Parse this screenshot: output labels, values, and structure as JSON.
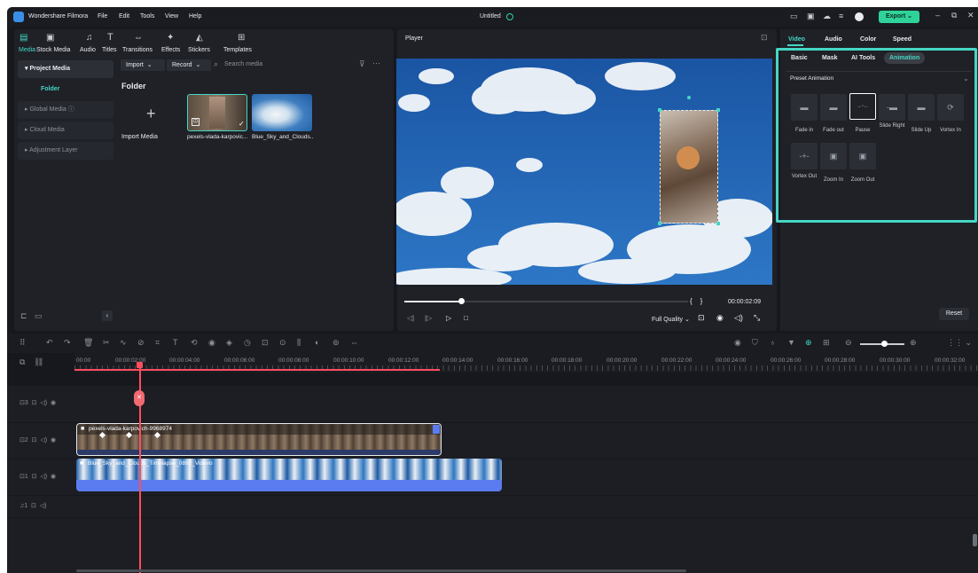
{
  "app": {
    "name": "Wondershare Filmora",
    "project_title": "Untitled",
    "menu": [
      "File",
      "Edit",
      "Tools",
      "View",
      "Help"
    ],
    "export_label": "Export"
  },
  "toolbar": {
    "tabs": [
      "Media",
      "Stock Media",
      "Audio",
      "Titles",
      "Transitions",
      "Effects",
      "Stickers",
      "Templates"
    ],
    "active_tab": "Media"
  },
  "sidebar": {
    "items": [
      "Project Media",
      "Folder",
      "Global Media",
      "Cloud Media",
      "Adjustment Layer"
    ]
  },
  "media": {
    "import_label": "Import",
    "record_label": "Record",
    "search_placeholder": "Search media",
    "folder_title": "Folder",
    "import_media_label": "Import Media",
    "clips": [
      "pexels-vlada-karpovic...",
      "Blue_Sky_and_Clouds..."
    ]
  },
  "player": {
    "title": "Player",
    "timecode": "00:00:02:09",
    "quality": "Full Quality",
    "progress": 0.2
  },
  "properties": {
    "tabs": [
      "Video",
      "Audio",
      "Color",
      "Speed"
    ],
    "active_tab": "Video",
    "subtabs": [
      "Basic",
      "Mask",
      "AI Tools",
      "Animation"
    ],
    "active_subtab": "Animation",
    "preset_label": "Preset Animation",
    "animations": [
      "Fade in",
      "Fade out",
      "Pause",
      "Slide Right",
      "Slide Up",
      "Vortex In",
      "Vortex Out",
      "Zoom In",
      "Zoom Out"
    ],
    "selected_animation": "Pause",
    "reset_label": "Reset"
  },
  "timeline": {
    "ruler": [
      "00:00",
      "00:00:02:00",
      "00:00:04:00",
      "00:00:06:00",
      "00:00:08:00",
      "00:00:10:00",
      "00:00:12:00",
      "00:00:14:00",
      "00:00:16:00",
      "00:00:18:00",
      "00:00:20:00",
      "00:00:22:00",
      "00:00:24:00",
      "00:00:26:00",
      "00:00:28:00",
      "00:00:30:00",
      "00:00:32:00"
    ],
    "tracks": [
      "3",
      "2",
      "1",
      "1"
    ],
    "clips": [
      "pexels-vlada-karpovich-9968974",
      "Blue_Sky_and_Clouds_Timelapse_0892_Videvo"
    ]
  },
  "colors": {
    "accent": "#45d6c4",
    "export": "#2fd39a",
    "playhead": "#ff4d5e",
    "audio_clip": "#5b7cf0"
  }
}
